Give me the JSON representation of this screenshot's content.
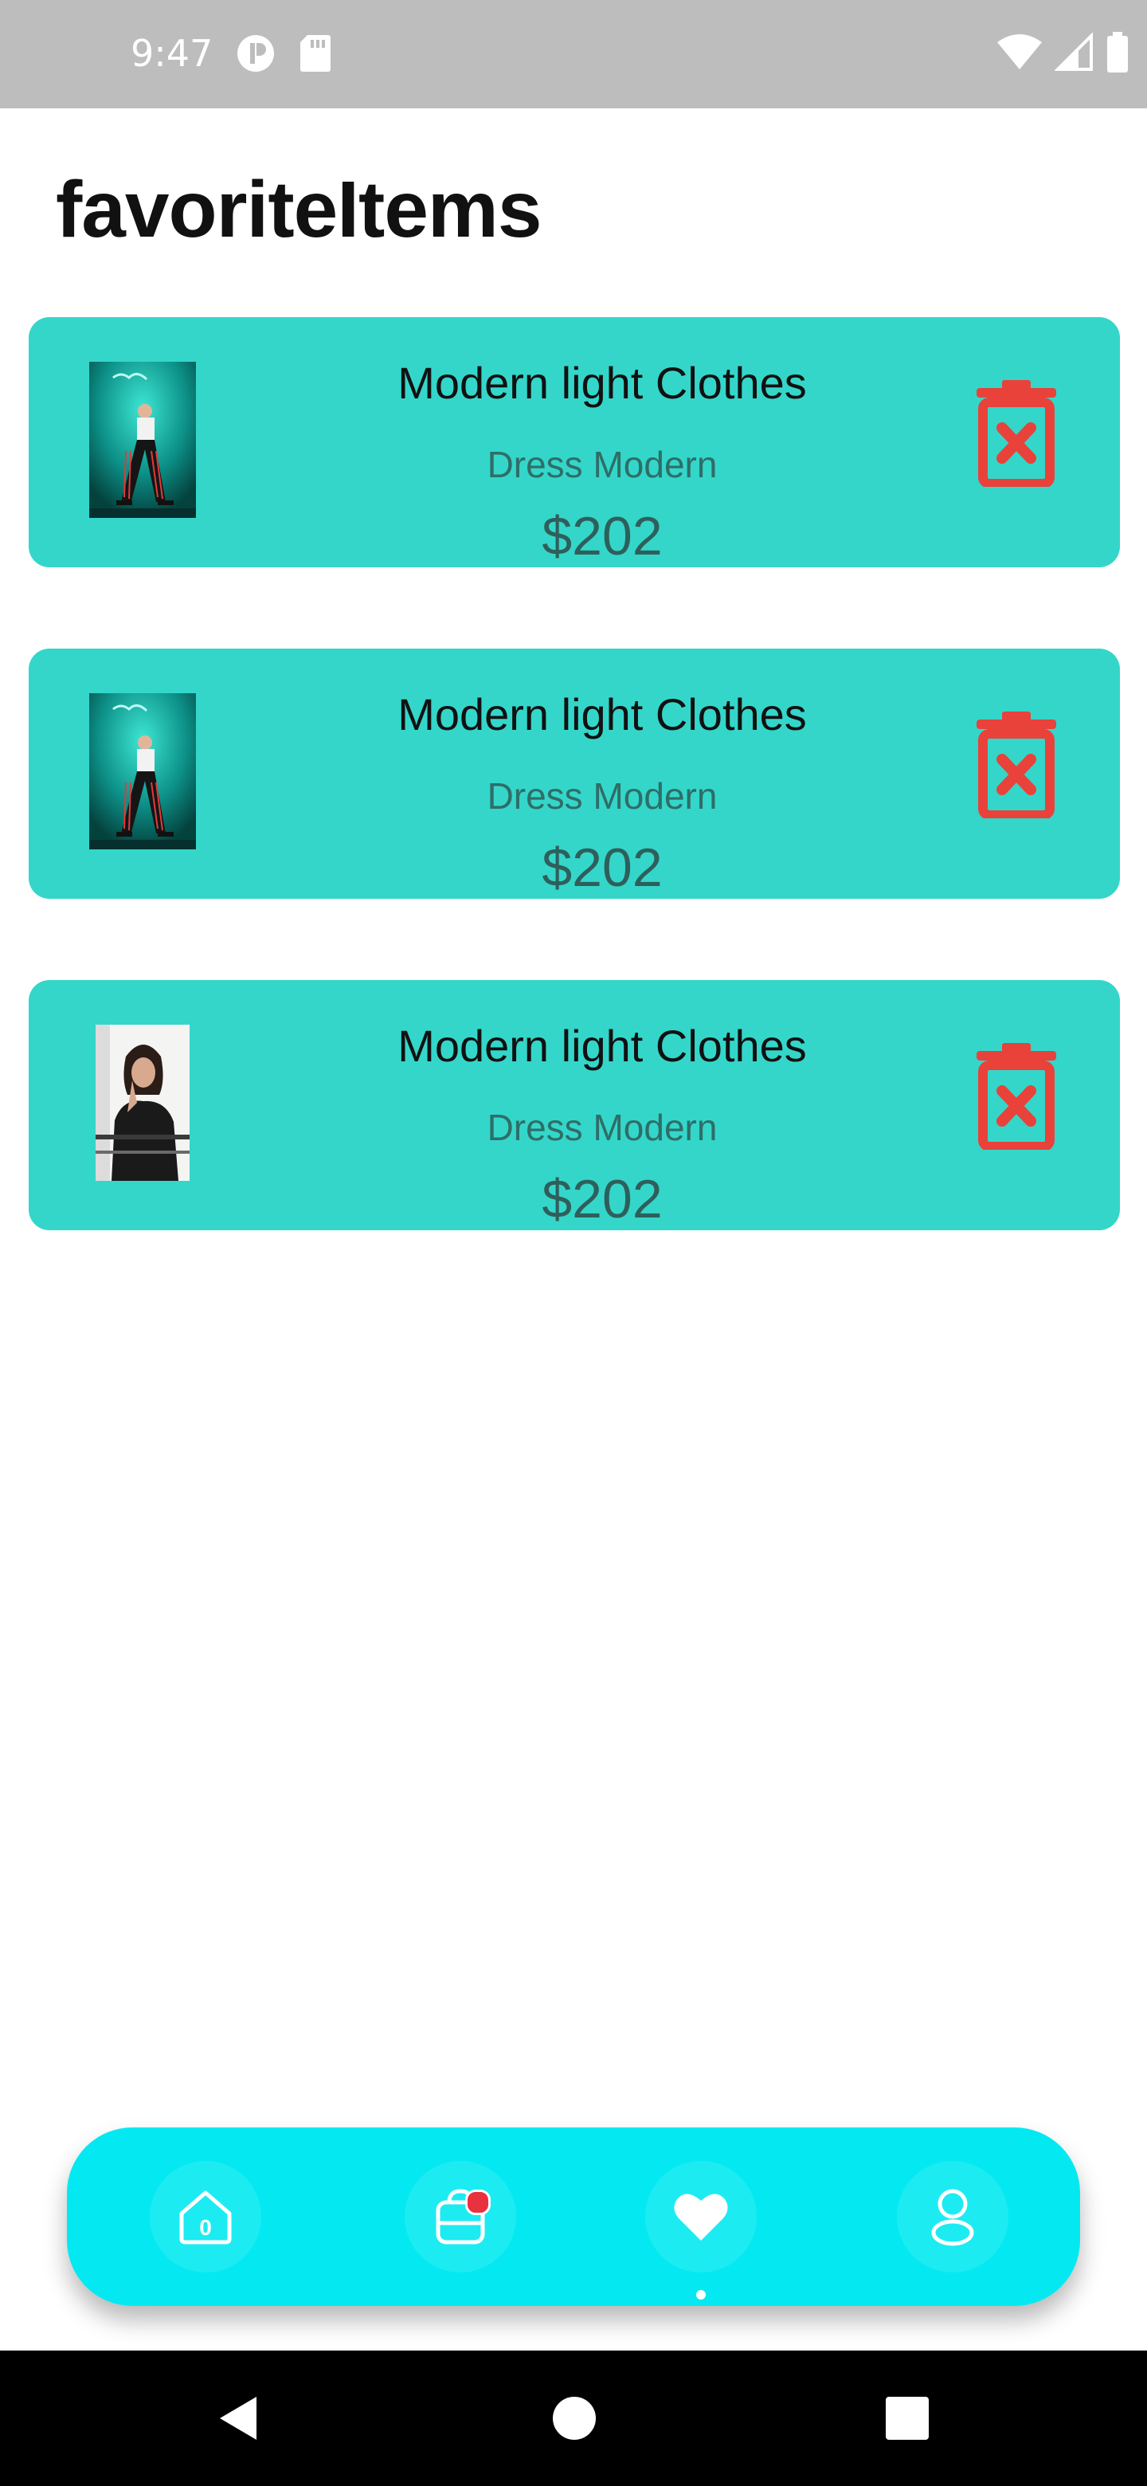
{
  "status_bar": {
    "time": "9:47",
    "icons": [
      "app-notification-icon",
      "sd-card-icon",
      "wifi-icon",
      "cellular-signal-icon",
      "battery-icon"
    ]
  },
  "page": {
    "title": "favoriteItems"
  },
  "favorites": [
    {
      "title": "Modern light Clothes",
      "subtitle": "Dress Modern",
      "price": "$202",
      "image": "teal-neon-fashion-photo"
    },
    {
      "title": "Modern light Clothes",
      "subtitle": "Dress Modern",
      "price": "$202",
      "image": "teal-neon-fashion-photo"
    },
    {
      "title": "Modern light Clothes",
      "subtitle": "Dress Modern",
      "price": "$202",
      "image": "woman-black-outfit-photo"
    }
  ],
  "bottom_nav": {
    "items": [
      {
        "icon": "home-icon",
        "count": "0"
      },
      {
        "icon": "shopping-bag-icon",
        "badge": true
      },
      {
        "icon": "heart-icon",
        "active": true
      },
      {
        "icon": "profile-icon"
      }
    ]
  },
  "colors": {
    "card_bg": "#34d6ca",
    "delete_icon": "#e8423a",
    "nav_bg": "#04e9f1",
    "status_bar_bg": "#bdbdbd"
  }
}
